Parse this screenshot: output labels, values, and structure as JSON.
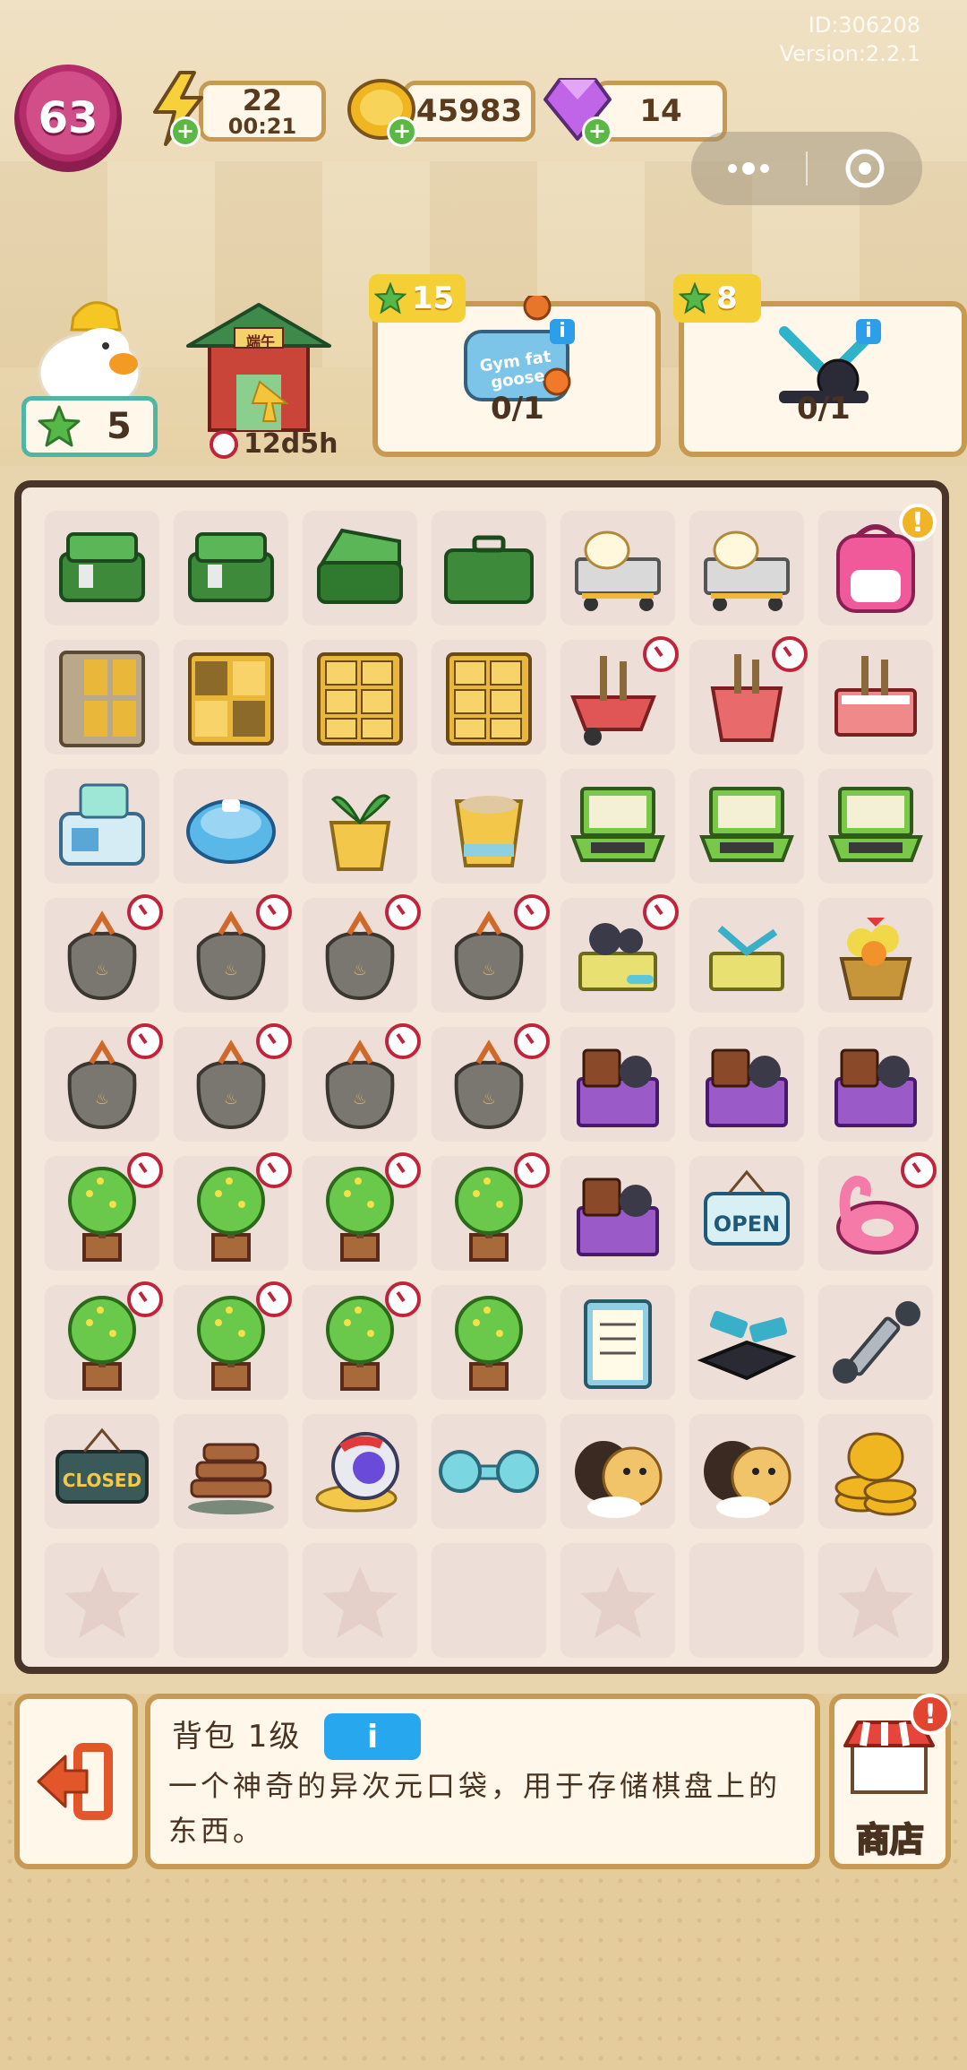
{
  "meta": {
    "id_text": "ID:306208",
    "version_text": "Version:2.2.1"
  },
  "player": {
    "level": "63"
  },
  "resources": {
    "energy": {
      "value": "22",
      "timer": "00:21"
    },
    "coins": {
      "value": "45983"
    },
    "gems": {
      "value": "14"
    }
  },
  "stars": {
    "count": "5"
  },
  "event": {
    "building_sign": "端午",
    "timer": "12d5h"
  },
  "orders": [
    {
      "reward": "15",
      "progress": "0/1",
      "item_text": "Gym fat goose"
    },
    {
      "reward": "8",
      "progress": "0/1"
    }
  ],
  "board": {
    "rows": [
      [
        "toolbox-open-green",
        "toolbox-open-green",
        "toolbox-lid-green",
        "toolbox-closed-green",
        "duck-cart",
        "duck-cart",
        "backpack"
      ],
      [
        "locker-grey",
        "locker-open",
        "locker-yellow",
        "locker-yellow",
        "wheelbarrow-tools",
        "bucket-tools",
        "basket-tools"
      ],
      [
        "ice-machine",
        "robot-vacuum",
        "plant-pot",
        "empty-pot",
        "laptop",
        "laptop",
        "laptop"
      ],
      [
        "trash-bag",
        "trash-bag",
        "trash-bag",
        "trash-bag",
        "gym-cart",
        "gym-cart-empty",
        "flower-basket"
      ],
      [
        "trash-bag",
        "trash-bag",
        "trash-bag",
        "trash-bag",
        "gym-box-purple",
        "gym-box-purple",
        "gym-box-purple"
      ],
      [
        "potted-tree",
        "potted-tree",
        "potted-tree",
        "potted-tree",
        "gym-box-purple",
        "open-sign",
        "flamingo-float"
      ],
      [
        "potted-tree",
        "potted-tree",
        "potted-tree",
        "potted-tree",
        "clipboard",
        "weight-bench",
        "hand-grip"
      ],
      [
        "closed-sign",
        "wood-pile",
        "snail-robot",
        "dumbbell",
        "hamsters",
        "hamsters",
        "coin-stack"
      ],
      [
        "empty-star",
        "empty",
        "empty-star",
        "empty",
        "empty-star",
        "empty",
        "empty-star"
      ]
    ],
    "timers": [
      "4-5",
      "4-6",
      "5-0",
      "5-1",
      "5-2",
      "5-3",
      "6-0",
      "6-1",
      "6-2",
      "6-3",
      "7-0",
      "7-1",
      "7-2",
      "7-3",
      "8-0",
      "8-1",
      "8-2",
      "8-3",
      "9-0",
      "9-1",
      "9-2",
      "9-3",
      "10-0",
      "10-1",
      "10-2",
      "10-3"
    ],
    "open_sign": "OPEN",
    "closed_sign": "CLOSED"
  },
  "selection": {
    "title": "背包 1级",
    "info_label": "i",
    "description": "一个神奇的异次元口袋，用于存储棋盘上的东西。"
  },
  "shop": {
    "label": "商店",
    "alert": "!"
  },
  "colors": {
    "wood": "#c79a54",
    "board_border": "#4a3628",
    "cell": "#eeded8",
    "accent_blue": "#27a7ee"
  }
}
